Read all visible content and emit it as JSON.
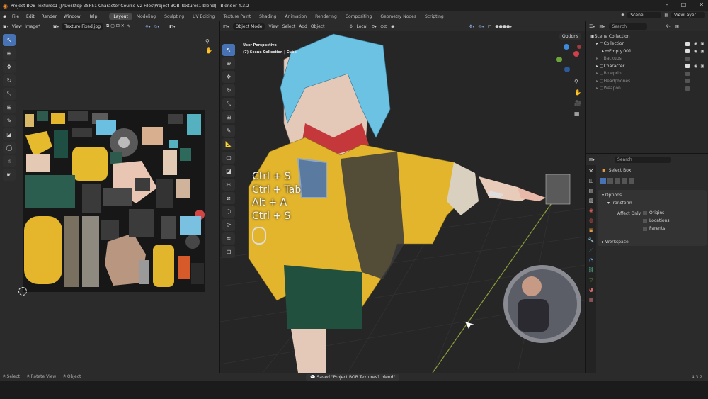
{
  "window": {
    "title": "Project BOB Textures1 [J:\\Desktop ZSP51 Character Course V2 Files\\Project BOB Textures1.blend] - Blender 4.3.2",
    "minimize": "–",
    "maximize": "□",
    "close": "✕"
  },
  "menu": [
    "File",
    "Edit",
    "Render",
    "Window",
    "Help"
  ],
  "workspaces": [
    "Layout",
    "Modeling",
    "Sculpting",
    "UV Editing",
    "Texture Paint",
    "Shading",
    "Animation",
    "Rendering",
    "Compositing",
    "Geometry Nodes",
    "Scripting",
    "···"
  ],
  "scene": {
    "label": "Scene",
    "view_layer": "ViewLayer"
  },
  "uv_editor": {
    "menus": [
      "View",
      "Image*"
    ],
    "image_name": "Texture Fixed.jpg"
  },
  "viewport": {
    "mode": "Object Mode",
    "menus": [
      "View",
      "Select",
      "Add",
      "Object"
    ],
    "transform": "Local",
    "options": "Options",
    "overlay_title": "User Perspective",
    "overlay_sub": "(7) Scene Collection | Cube",
    "keys": [
      "Ctrl + S",
      "Ctrl + Tab",
      "Alt + A",
      "Ctrl + S"
    ]
  },
  "outliner": {
    "search_placeholder": "Search",
    "rows": [
      {
        "label": "Scene Collection",
        "indent": 0,
        "dim": false
      },
      {
        "label": "Collection",
        "indent": 1,
        "dim": false,
        "vis": true
      },
      {
        "label": "Empty.001",
        "indent": 2,
        "dim": false,
        "vis": true
      },
      {
        "label": "Backups",
        "indent": 1,
        "dim": true
      },
      {
        "label": "Character",
        "indent": 1,
        "dim": false,
        "vis": true
      },
      {
        "label": "Blueprint",
        "indent": 1,
        "dim": true
      },
      {
        "label": "Headphones",
        "indent": 1,
        "dim": true
      },
      {
        "label": "Weapon",
        "indent": 1,
        "dim": true
      }
    ]
  },
  "properties": {
    "search_placeholder": "Search",
    "tool": "Select Box",
    "options": "Options",
    "transform": "Transform",
    "affect_only": "Affect Only",
    "origins": "Origins",
    "locations": "Locations",
    "parents": "Parents",
    "workspace": "Workspace"
  },
  "status": {
    "select": "Select",
    "rotate": "Rotate View",
    "object": "Object",
    "saved": "Saved \"Project BOB Textures1.blend\"",
    "version": "4.3.2"
  },
  "colors": {
    "accent": "#4772b3",
    "yellow": "#e2b52a",
    "hair": "#6ec3e0",
    "skin": "#e8cbb8"
  }
}
